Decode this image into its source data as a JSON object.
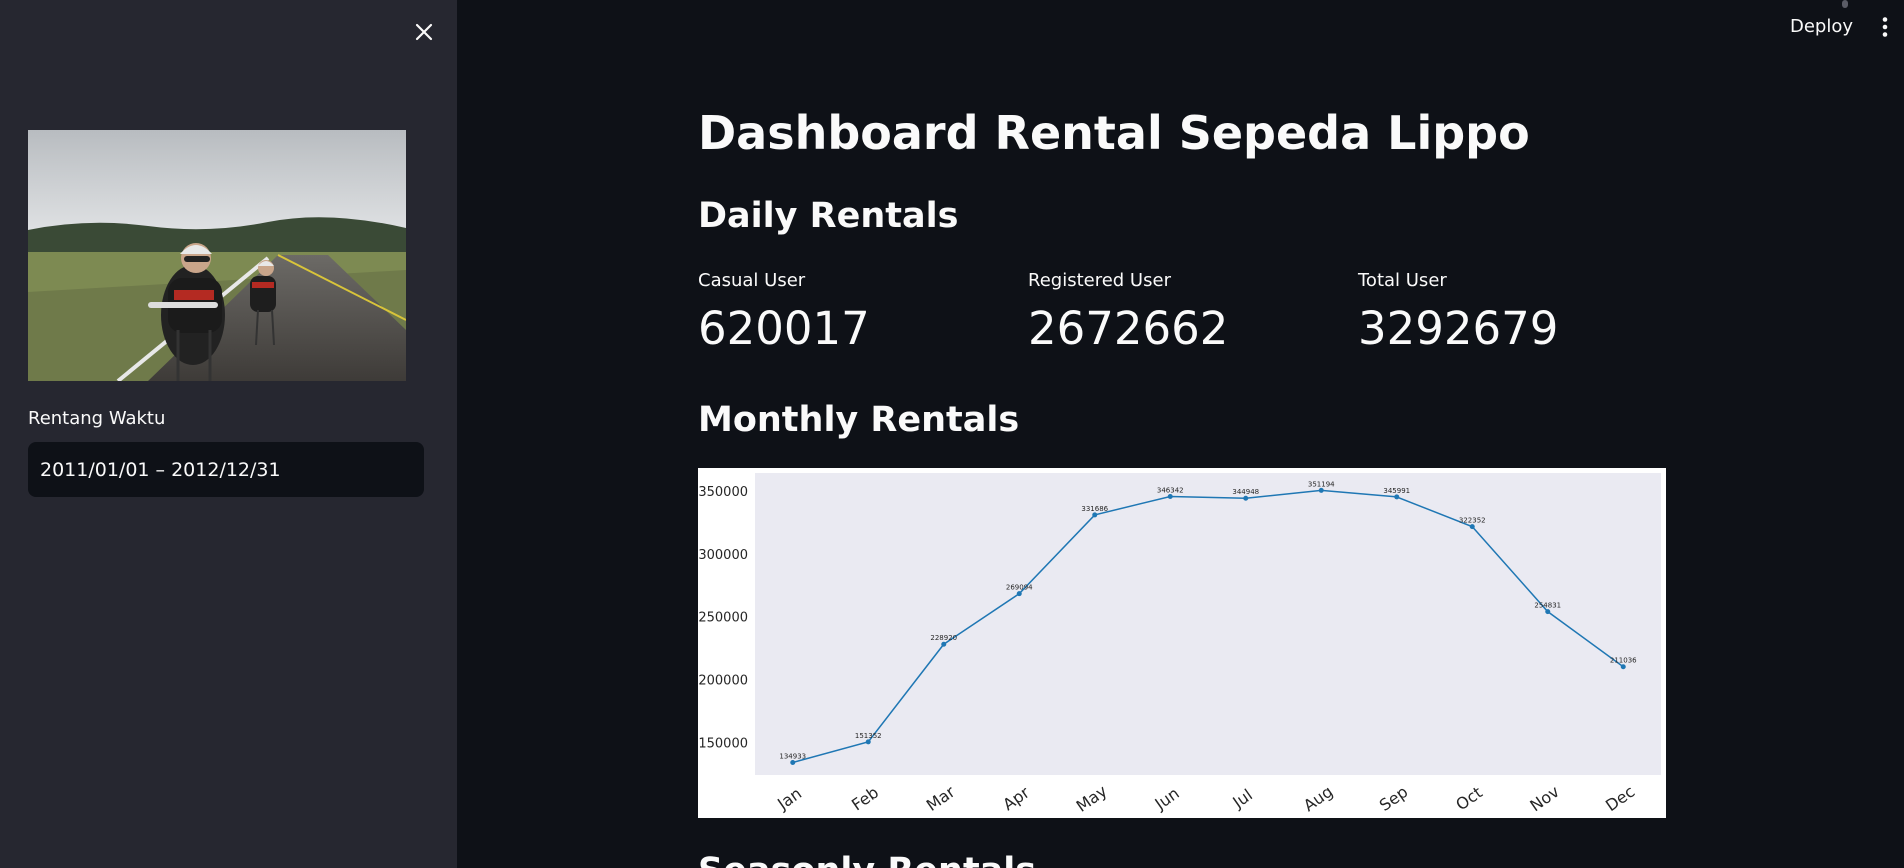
{
  "sidebar": {
    "range_label": "Rentang Waktu",
    "range_value": "2011/01/01 – 2012/12/31",
    "close_icon": "close-icon",
    "image": "cyclists-on-road-photo"
  },
  "header": {
    "deploy_label": "Deploy",
    "menu_icon": "vertical-dots-icon"
  },
  "main": {
    "title": "Dashboard Rental Sepeda Lippo",
    "daily_heading": "Daily Rentals",
    "metrics": [
      {
        "label": "Casual User",
        "value": "620017"
      },
      {
        "label": "Registered User",
        "value": "2672662"
      },
      {
        "label": "Total User",
        "value": "3292679"
      }
    ],
    "monthly_heading": "Monthly Rentals",
    "seasonly_heading": "Seasonly Rentals"
  },
  "colors": {
    "background": "#0e1117",
    "sidebar": "#262730",
    "line": "#1f77b4",
    "plot_bg": "#eaeaf2"
  },
  "chart_data": {
    "type": "line",
    "categories": [
      "Jan",
      "Feb",
      "Mar",
      "Apr",
      "May",
      "Jun",
      "Jul",
      "Aug",
      "Sep",
      "Oct",
      "Nov",
      "Dec"
    ],
    "values": [
      134933,
      151352,
      228920,
      269094,
      331686,
      346342,
      344948,
      351194,
      345991,
      322352,
      254831,
      211036
    ],
    "ylim": [
      125000,
      365000
    ],
    "yticks": [
      150000,
      200000,
      250000,
      300000,
      350000
    ],
    "grid": false,
    "title": "",
    "xlabel": "",
    "ylabel": ""
  }
}
